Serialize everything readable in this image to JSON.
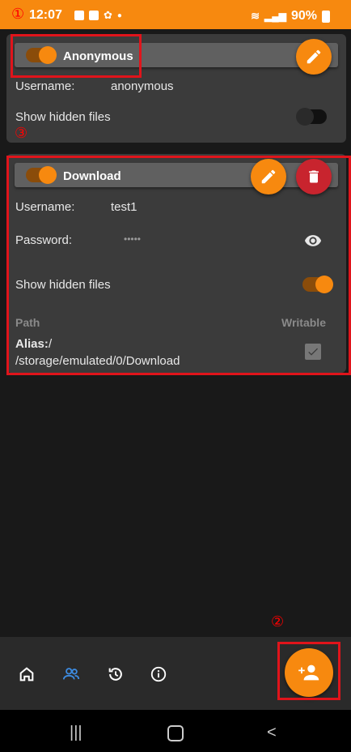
{
  "status": {
    "time": "12:07",
    "battery": "90%"
  },
  "annotations": {
    "one": "①",
    "two": "②",
    "three": "③"
  },
  "card1": {
    "title": "Anonymous",
    "username_label": "Username:",
    "username_value": "anonymous",
    "hidden_label": "Show hidden files",
    "enabled": true,
    "show_hidden": false
  },
  "card2": {
    "title": "Download",
    "username_label": "Username:",
    "username_value": "test1",
    "password_label": "Password:",
    "password_value": "•••••",
    "hidden_label": "Show hidden files",
    "path_header": "Path",
    "writable_header": "Writable",
    "alias_label": "Alias:",
    "alias_value": "/",
    "path_value": "/storage/emulated/0/Download",
    "enabled": true,
    "show_hidden": true,
    "writable": true
  },
  "bottom_nav": {
    "items": [
      "home-icon",
      "users-icon",
      "history-icon",
      "info-icon"
    ],
    "active": "users-icon"
  },
  "colors": {
    "accent": "#f7890f",
    "danger": "#c8242e",
    "active_nav": "#3d8be0",
    "annotation": "#e0141b"
  }
}
